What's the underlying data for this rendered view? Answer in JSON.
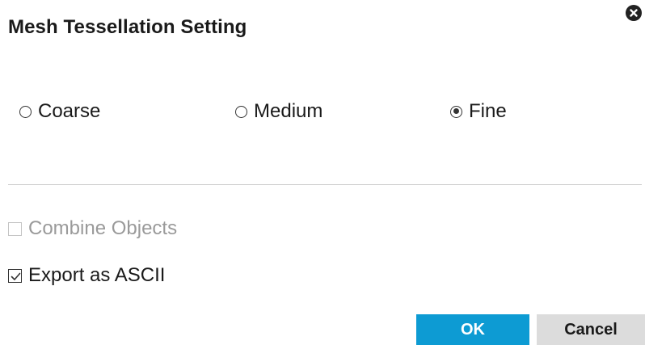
{
  "dialog": {
    "title": "Mesh Tessellation Setting",
    "close_icon": "close-circle-icon"
  },
  "quality": {
    "options": [
      {
        "label": "Coarse",
        "selected": false
      },
      {
        "label": "Medium",
        "selected": false
      },
      {
        "label": "Fine",
        "selected": true
      }
    ],
    "selected": "Fine"
  },
  "options": {
    "combine_objects": {
      "label": "Combine Objects",
      "checked": false,
      "disabled": true
    },
    "export_ascii": {
      "label": "Export as ASCII",
      "checked": true,
      "disabled": false
    }
  },
  "buttons": {
    "ok_label": "OK",
    "cancel_label": "Cancel"
  },
  "colors": {
    "primary": "#0d9bd3",
    "secondary": "#dcdcdc",
    "disabled_text": "#9a9a9a"
  }
}
